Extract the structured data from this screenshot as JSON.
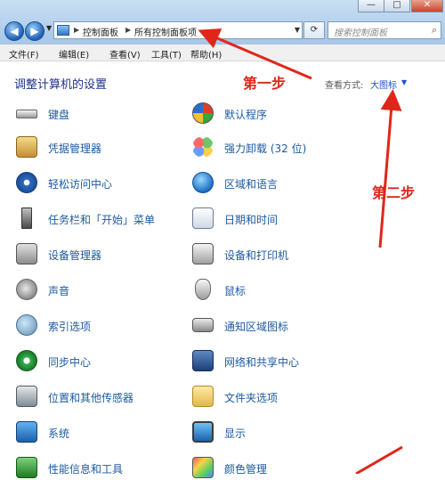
{
  "window": {
    "minimize_label": "—",
    "maximize_label": "□",
    "close_label": "✕"
  },
  "address_bar": {
    "crumbs": [
      "控制面板",
      "所有控制面板项"
    ],
    "search_placeholder": "搜索控制面板"
  },
  "menu": {
    "items": [
      "文件(F)",
      "编辑(E)",
      "查看(V)",
      "工具(T)",
      "帮助(H)"
    ]
  },
  "header": {
    "title": "调整计算机的设置",
    "view_by_label": "查看方式:",
    "view_by_value": "大图标"
  },
  "items_left": [
    {
      "label": "键盘",
      "icon": "keyboard-icon"
    },
    {
      "label": "凭据管理器",
      "icon": "credential-vault-icon"
    },
    {
      "label": "轻松访问中心",
      "icon": "ease-of-access-icon"
    },
    {
      "label": "任务栏和「开始」菜单",
      "icon": "taskbar-icon"
    },
    {
      "label": "设备管理器",
      "icon": "device-manager-icon"
    },
    {
      "label": "声音",
      "icon": "speaker-icon"
    },
    {
      "label": "索引选项",
      "icon": "indexing-icon"
    },
    {
      "label": "同步中心",
      "icon": "sync-icon"
    },
    {
      "label": "位置和其他传感器",
      "icon": "sensor-icon"
    },
    {
      "label": "系统",
      "icon": "system-icon"
    },
    {
      "label": "性能信息和工具",
      "icon": "performance-icon"
    }
  ],
  "items_right": [
    {
      "label": "默认程序",
      "icon": "default-programs-icon"
    },
    {
      "label": "强力卸载 (32 位)",
      "icon": "uninstall-icon"
    },
    {
      "label": "区域和语言",
      "icon": "globe-icon"
    },
    {
      "label": "日期和时间",
      "icon": "calendar-clock-icon"
    },
    {
      "label": "设备和打印机",
      "icon": "printer-icon"
    },
    {
      "label": "鼠标",
      "icon": "mouse-icon"
    },
    {
      "label": "通知区域图标",
      "icon": "notification-tray-icon"
    },
    {
      "label": "网络和共享中心",
      "icon": "network-icon"
    },
    {
      "label": "文件夹选项",
      "icon": "folder-icon"
    },
    {
      "label": "显示",
      "icon": "display-icon"
    },
    {
      "label": "颜色管理",
      "icon": "color-management-icon"
    }
  ],
  "annotations": {
    "step1": "第一步",
    "step2": "第二步"
  },
  "colors": {
    "annotation_red": "#e0261b",
    "link_blue": "#1e5aa0",
    "title_blue": "#1e3287"
  }
}
